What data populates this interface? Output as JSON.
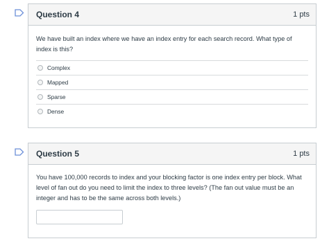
{
  "questions": [
    {
      "title": "Question 4",
      "points": "1 pts",
      "text": "We have built an index where we have an index entry for each search record. What type of index is this?",
      "options": [
        "Complex",
        "Mapped",
        "Sparse",
        "Dense"
      ]
    },
    {
      "title": "Question 5",
      "points": "1 pts",
      "text": "You have 100,000 records to index and your blocking factor is one index entry per block. What level of fan out do you need to limit the index to three levels? (The fan out value must be an integer and has to be the same across both levels.)",
      "answer_value": ""
    }
  ],
  "colors": {
    "flag": "#6b8fd8",
    "border": "#c7cdd1",
    "header_bg": "#f5f5f5"
  }
}
